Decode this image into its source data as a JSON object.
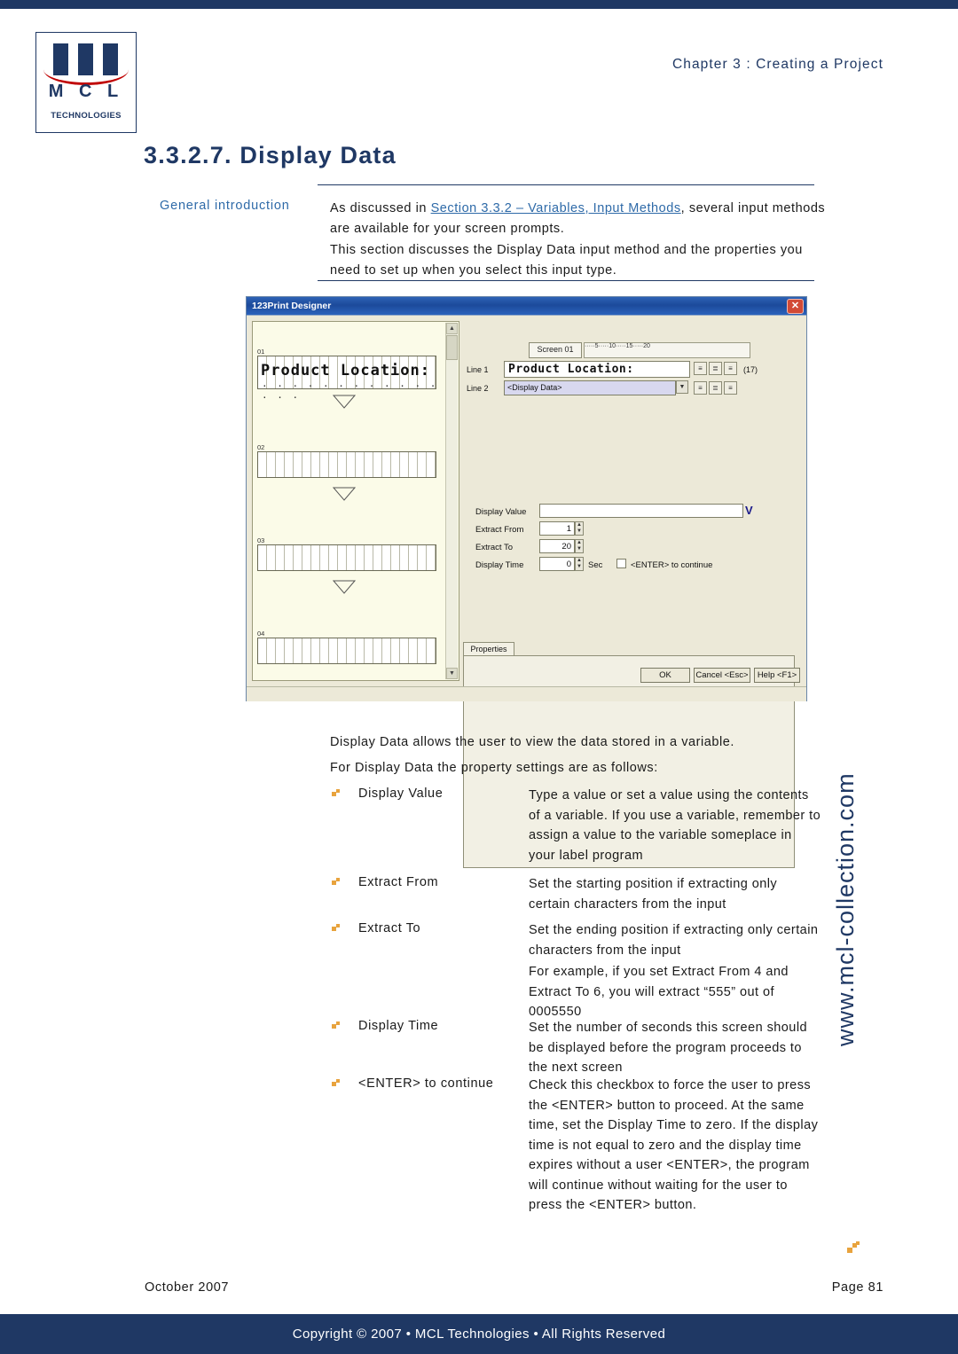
{
  "header": {
    "chapter": "Chapter 3 : Creating a Project",
    "logo_mcl": "M C L",
    "logo_tech": "TECHNOLOGIES"
  },
  "section": {
    "number_title": "3.3.2.7.  Display Data",
    "general_intro_label": "General introduction",
    "paragraph_1_prefix": "As discussed in ",
    "paragraph_1_link": "Section 3.3.2 – Variables, Input Methods",
    "paragraph_1_suffix": ", several input methods are available for your screen prompts.",
    "paragraph_2": "This section discusses the Display Data input method and the properties you need to set up when you select this input type."
  },
  "app": {
    "window_title": "123Print Designer",
    "close_label": "✕",
    "design": {
      "labels": [
        "01",
        "02",
        "03",
        "04"
      ],
      "prompt_text": "Product Location:",
      "dot_row": "· · · · · · · · · · · · · · · ·",
      "scroll_up": "▲",
      "scroll_down": "▼"
    },
    "editor": {
      "screen_tab": "Screen 01",
      "ruler_ticks": "·····5·····10·····15·····20",
      "line1_label": "Line 1",
      "line1_value": "Product Location:",
      "line1_count": "(17)",
      "line2_label": "Line 2",
      "line2_value": "<Display Data>",
      "combo_arrow": "▼",
      "align_left_icon": "≡",
      "align_center_icon": "≣",
      "align_right_icon": "≡"
    },
    "properties": {
      "tab_label": "Properties",
      "display_value_label": "Display Value",
      "display_value": "",
      "display_value_dropdown": "V",
      "extract_from_label": "Extract From",
      "extract_from_value": "1",
      "extract_to_label": "Extract To",
      "extract_to_value": "20",
      "display_time_label": "Display Time",
      "display_time_value": "0",
      "display_time_unit": "Sec",
      "enter_checkbox_label": "<ENTER> to continue",
      "spin_up": "▲",
      "spin_down": "▼"
    },
    "buttons": {
      "ok": "OK",
      "cancel": "Cancel <Esc>",
      "help": "Help <F1>"
    }
  },
  "body": {
    "intro_line_1": "Display Data allows the user to view the data stored in a variable.",
    "intro_line_2": "For Display Data the property settings are as follows:",
    "properties": [
      {
        "term": "Display Value",
        "desc": "Type a value or set a value using the contents of a variable. If you use a variable, remember to assign a value to the variable someplace in your label program"
      },
      {
        "term": "Extract From",
        "desc": "Set the starting position if extracting only certain characters from the input"
      },
      {
        "term": "Extract To",
        "desc": "Set the ending position if extracting only certain characters from the input"
      },
      {
        "term": "",
        "desc": "For example, if you set Extract From 4 and Extract To 6, you will extract “555” out of 0005550"
      },
      {
        "term": "Display Time",
        "desc": "Set the number of seconds this screen should be displayed before the program proceeds to the next screen"
      },
      {
        "term": "<ENTER> to continue",
        "desc": "Check this checkbox to force the user to press the <ENTER> button to proceed. At the same time, set the Display Time to zero. If the display time is not equal to zero and the display time expires without a user <ENTER>, the program will continue without waiting for the user to press the <ENTER> button."
      }
    ]
  },
  "watermark": {
    "text": "www.mcl-collection.com"
  },
  "footer": {
    "date": "October  2007",
    "page": "Page   81",
    "copyright": "Copyright © 2007 • MCL Technologies • All Rights Reserved"
  }
}
